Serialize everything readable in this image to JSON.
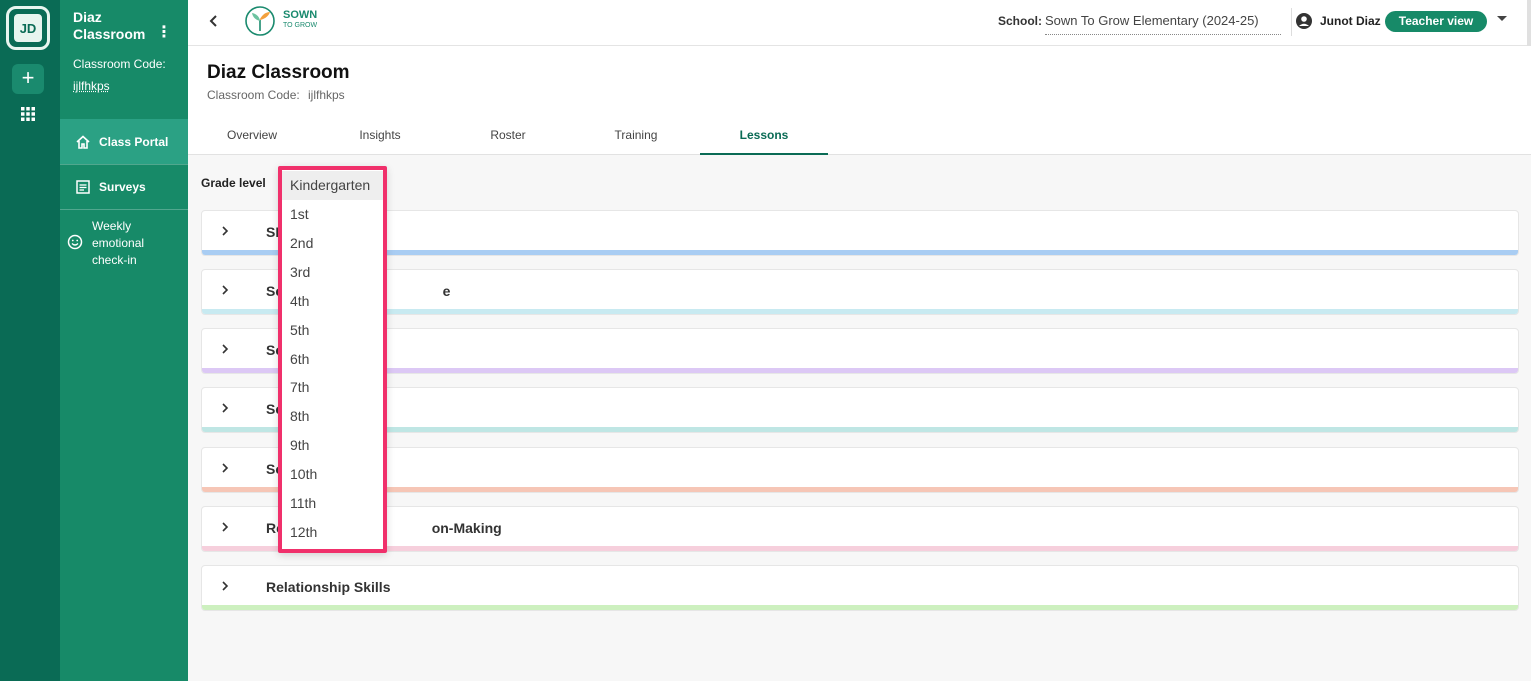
{
  "rail": {
    "avatar_initials": "JD"
  },
  "sidepanel": {
    "title": "Diaz Classroom",
    "code_label": "Classroom Code:",
    "code": "ijlfhkps",
    "nav": [
      {
        "label": "Class Portal",
        "icon": "home-icon",
        "active": true
      },
      {
        "label": "Surveys",
        "icon": "survey-icon",
        "active": false
      },
      {
        "label": "Weekly emotional check-in",
        "icon": "smiley-icon",
        "active": false
      }
    ]
  },
  "header": {
    "logo_text": "SOWN",
    "logo_sub": "TO GROW",
    "school_label": "School:",
    "school_value": "Sown To Grow Elementary (2024-25)",
    "user_name": "Junot Diaz",
    "view_button": "Teacher view"
  },
  "page": {
    "title": "Diaz Classroom",
    "code_label": "Classroom Code:",
    "code": "ijlfhkps",
    "tabs": [
      "Overview",
      "Insights",
      "Roster",
      "Training",
      "Lessons"
    ],
    "active_tab": "Lessons"
  },
  "filter": {
    "grade_label": "Grade level",
    "options": [
      "Kindergarten",
      "1st",
      "2nd",
      "3rd",
      "4th",
      "5th",
      "6th",
      "7th",
      "8th",
      "9th",
      "10th",
      "11th",
      "12th"
    ],
    "selected": "Kindergarten"
  },
  "cards": [
    {
      "title": "SE",
      "color": "#a9cdf3"
    },
    {
      "title": "Se                                         e",
      "color": "#c8eaf1"
    },
    {
      "title": "Se",
      "color": "#dcc8f5"
    },
    {
      "title": "Se",
      "color": "#bfe6e4"
    },
    {
      "title": "So",
      "color": "#f6c6b6"
    },
    {
      "title": "Re                                      on-Making",
      "color": "#f6cfdc"
    },
    {
      "title": "Relationship Skills",
      "color": "#cdf0bf"
    }
  ],
  "colors": {
    "brand_dark": "#0a6b55",
    "brand": "#178a68",
    "highlight": "#f0306b"
  }
}
